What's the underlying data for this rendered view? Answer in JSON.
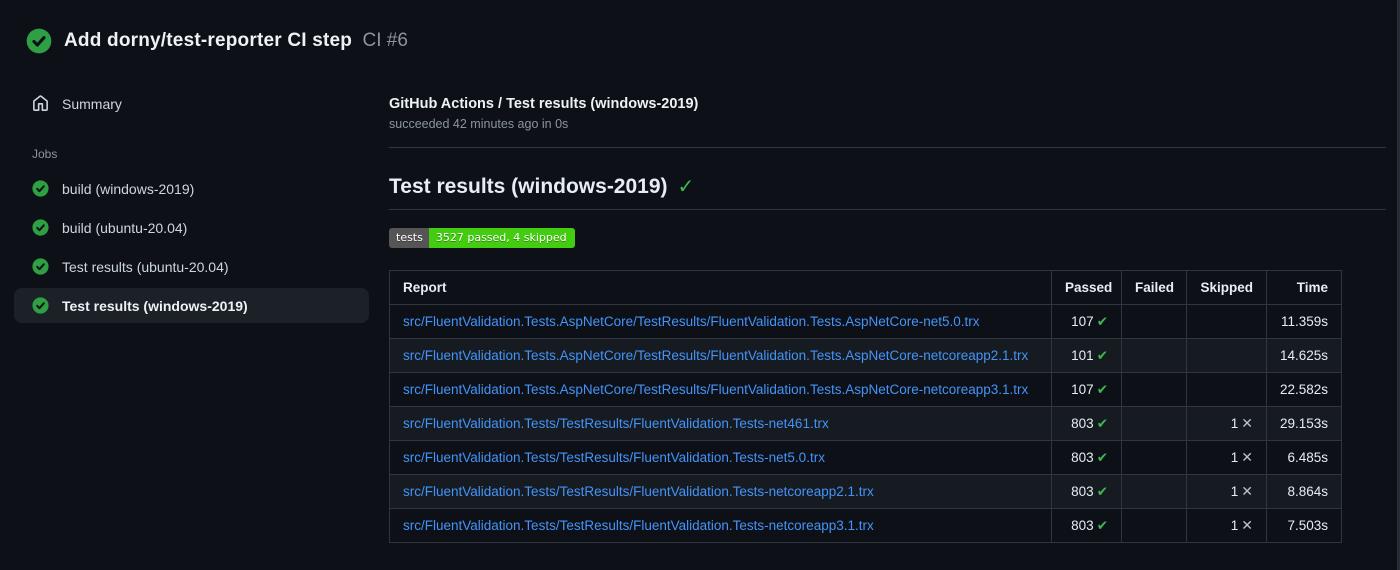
{
  "header": {
    "title": "Add dorny/test-reporter CI step",
    "run_number": "CI #6",
    "status": "success"
  },
  "sidebar": {
    "summary_label": "Summary",
    "jobs_label": "Jobs",
    "jobs": [
      {
        "label": "build (windows-2019)",
        "status": "success",
        "selected": false
      },
      {
        "label": "build (ubuntu-20.04)",
        "status": "success",
        "selected": false
      },
      {
        "label": "Test results (ubuntu-20.04)",
        "status": "success",
        "selected": false
      },
      {
        "label": "Test results (windows-2019)",
        "status": "success",
        "selected": true
      }
    ]
  },
  "main": {
    "job_title": "GitHub Actions / Test results (windows-2019)",
    "job_status": "succeeded 42 minutes ago in 0s",
    "heading": "Test results (windows-2019)",
    "heading_check": "✓",
    "badge": {
      "label": "tests",
      "value": "3527 passed, 4 skipped",
      "label_bg": "#555555",
      "value_bg": "#44cc11"
    },
    "table": {
      "headers": [
        "Report",
        "Passed",
        "Failed",
        "Skipped",
        "Time"
      ],
      "rows": [
        {
          "report": "src/FluentValidation.Tests.AspNetCore/TestResults/FluentValidation.Tests.AspNetCore-net5.0.trx",
          "passed": "107",
          "failed": "",
          "skipped": "",
          "time": "11.359s"
        },
        {
          "report": "src/FluentValidation.Tests.AspNetCore/TestResults/FluentValidation.Tests.AspNetCore-netcoreapp2.1.trx",
          "passed": "101",
          "failed": "",
          "skipped": "",
          "time": "14.625s"
        },
        {
          "report": "src/FluentValidation.Tests.AspNetCore/TestResults/FluentValidation.Tests.AspNetCore-netcoreapp3.1.trx",
          "passed": "107",
          "failed": "",
          "skipped": "",
          "time": "22.582s"
        },
        {
          "report": "src/FluentValidation.Tests/TestResults/FluentValidation.Tests-net461.trx",
          "passed": "803",
          "failed": "",
          "skipped": "1",
          "time": "29.153s"
        },
        {
          "report": "src/FluentValidation.Tests/TestResults/FluentValidation.Tests-net5.0.trx",
          "passed": "803",
          "failed": "",
          "skipped": "1",
          "time": "6.485s"
        },
        {
          "report": "src/FluentValidation.Tests/TestResults/FluentValidation.Tests-netcoreapp2.1.trx",
          "passed": "803",
          "failed": "",
          "skipped": "1",
          "time": "8.864s"
        },
        {
          "report": "src/FluentValidation.Tests/TestResults/FluentValidation.Tests-netcoreapp3.1.trx",
          "passed": "803",
          "failed": "",
          "skipped": "1",
          "time": "7.503s"
        }
      ],
      "passed_check_glyph": "✔",
      "skipped_x_glyph": "✕"
    }
  },
  "colors": {
    "page_bg": "#0d1117",
    "success_green": "#2ea043",
    "check_green": "#3fb950",
    "link_blue": "#4493f8",
    "border": "#30363d",
    "row_alt_bg": "#161b22",
    "selected_item_bg": "#1c2128",
    "secondary_text": "#8b949e"
  }
}
